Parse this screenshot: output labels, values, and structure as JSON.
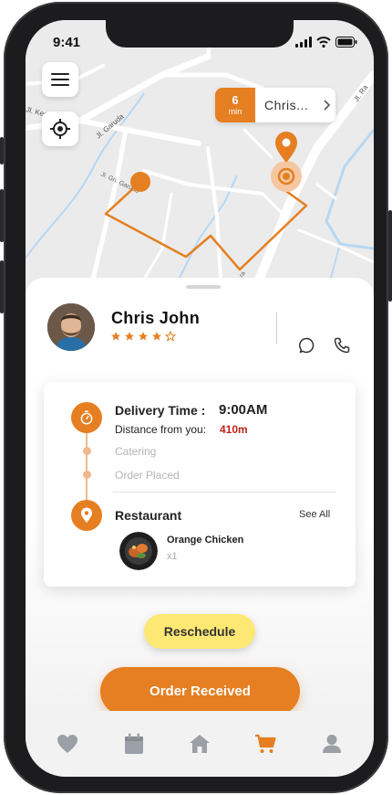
{
  "status_bar": {
    "time": "9:41"
  },
  "map": {
    "eta_value": "6",
    "eta_unit": "min",
    "eta_driver": "Chris...",
    "street_labels": [
      "Jl. Garuda",
      "Jl. Gn. Garuda",
      "Jl. Ra",
      "Jl. Kera",
      "ra"
    ]
  },
  "driver": {
    "name": "Chris John",
    "rating_stars": 4,
    "rating_max": 5
  },
  "delivery": {
    "time_label": "Delivery Time :",
    "time_value": "9:00AM",
    "distance_label": "Distance from you:",
    "distance_value": "410m",
    "steps": [
      "Catering",
      "Order Placed"
    ],
    "restaurant_label": "Restaurant",
    "see_all": "See All",
    "item_name": "Orange Chicken",
    "item_qty": "x1"
  },
  "actions": {
    "reschedule": "Reschedule",
    "order_received": "Order Received"
  },
  "tabs": [
    "heart-icon",
    "calendar-icon",
    "home-icon",
    "cart-icon",
    "profile-icon"
  ],
  "colors": {
    "accent": "#e57f22",
    "accent_light": "#f0b98b",
    "reschedule_bg": "#fde873",
    "distance_red": "#c0231b",
    "tab_inactive": "#9aa0a6"
  }
}
